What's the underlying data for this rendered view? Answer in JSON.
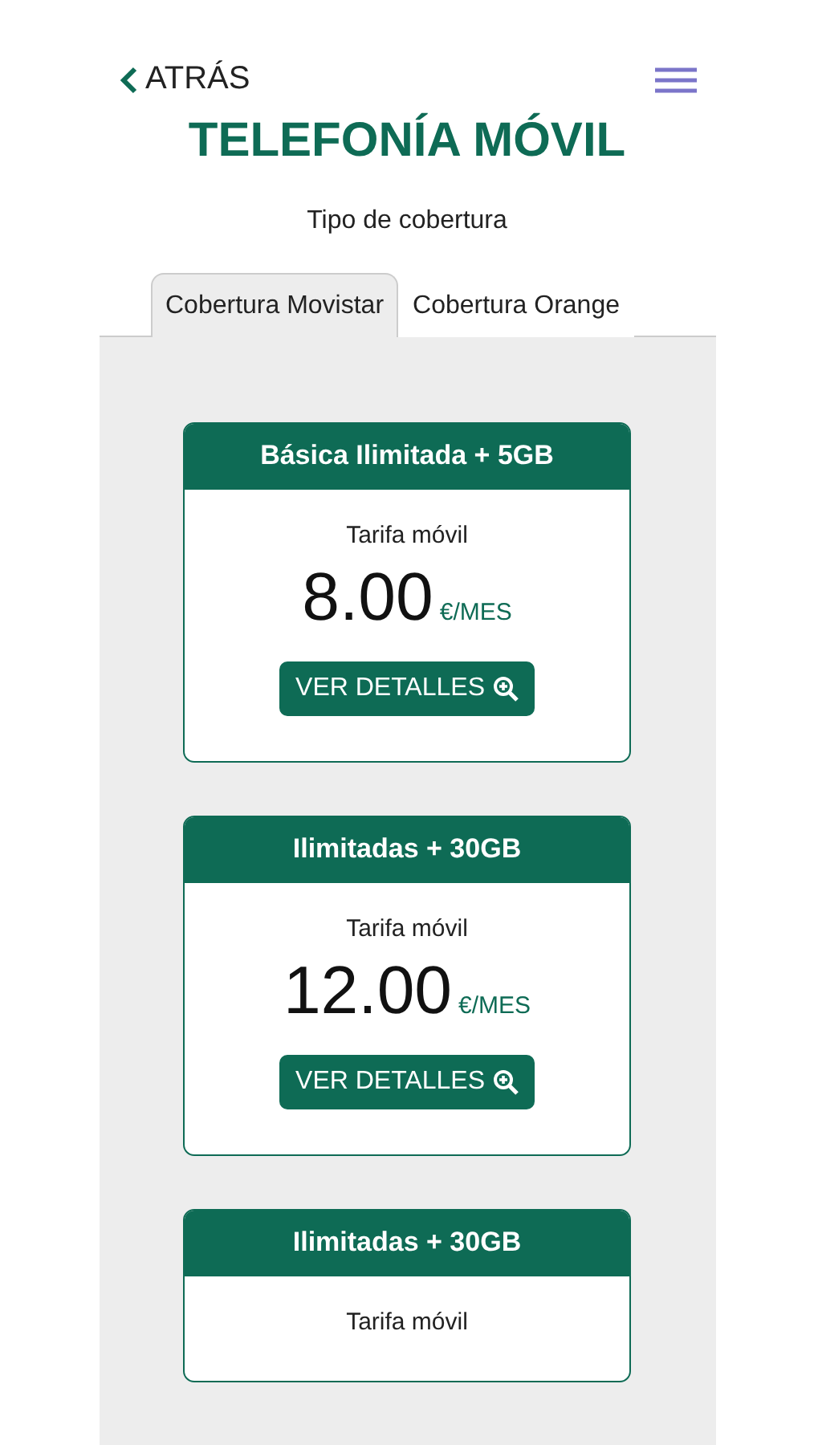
{
  "header": {
    "back": "ATRÁS",
    "title": "TELEFONÍA MÓVIL"
  },
  "coverage_label": "Tipo de cobertura",
  "tabs": [
    {
      "label": "Cobertura Movistar",
      "selected": true
    },
    {
      "label": "Cobertura Orange",
      "selected": false
    }
  ],
  "plans": [
    {
      "name": "Básica Ilimitada + 5GB",
      "subtitle": "Tarifa móvil",
      "price": "8.00",
      "unit": "€/MES",
      "button": "VER DETALLES"
    },
    {
      "name": "Ilimitadas + 30GB",
      "subtitle": "Tarifa móvil",
      "price": "12.00",
      "unit": "€/MES",
      "button": "VER DETALLES"
    },
    {
      "name": "Ilimitadas + 30GB",
      "subtitle": "Tarifa móvil"
    }
  ]
}
